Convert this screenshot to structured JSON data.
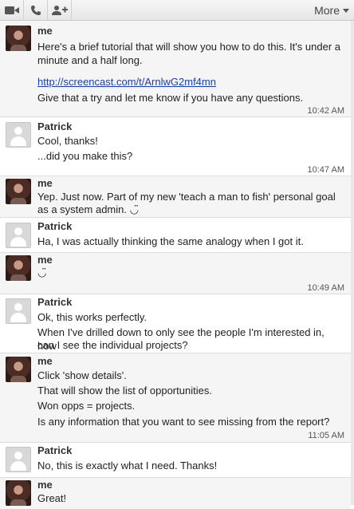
{
  "toolbar": {
    "video_icon": "video-camera-icon",
    "phone_icon": "phone-icon",
    "add_person_icon": "add-person-icon",
    "more_label": "More"
  },
  "messages": [
    {
      "sender": "me",
      "lines": [
        "Here's a brief tutorial that will show you how to do this. It's under a",
        "minute and a half long."
      ],
      "link": "http://screencast.com/t/ArnlwG2mf4mn",
      "after_link": "Give that a try and let me know if you have any questions.",
      "time": "10:42 AM"
    },
    {
      "sender": "Patrick",
      "lines": [
        "Cool, thanks!",
        "...did you make this?"
      ],
      "time": "10:47 AM"
    },
    {
      "sender": "me",
      "lines": [
        "Yep. Just now. Part of my new 'teach a man to fish' personal goal",
        "as a system admin. ◡̈"
      ]
    },
    {
      "sender": "Patrick",
      "lines": [
        "Ha, I was actually thinking the same analogy when I got it."
      ]
    },
    {
      "sender": "me",
      "lines": [
        "◡̈"
      ],
      "time": "10:49 AM"
    },
    {
      "sender": "Patrick",
      "lines": [
        "Ok, this works perfectly.",
        "When I've drilled down to only see the people I'm interested in, how",
        "can I see the individual projects?"
      ]
    },
    {
      "sender": "me",
      "lines": [
        "Click 'show details'.",
        "That will show the list of opportunities.",
        "Won opps = projects.",
        "Is any information that you want to see missing from the report?"
      ],
      "time": "11:05 AM"
    },
    {
      "sender": "Patrick",
      "lines": [
        "No, this is exactly what I need.  Thanks!"
      ]
    },
    {
      "sender": "me",
      "lines": [
        "Great!"
      ]
    }
  ]
}
